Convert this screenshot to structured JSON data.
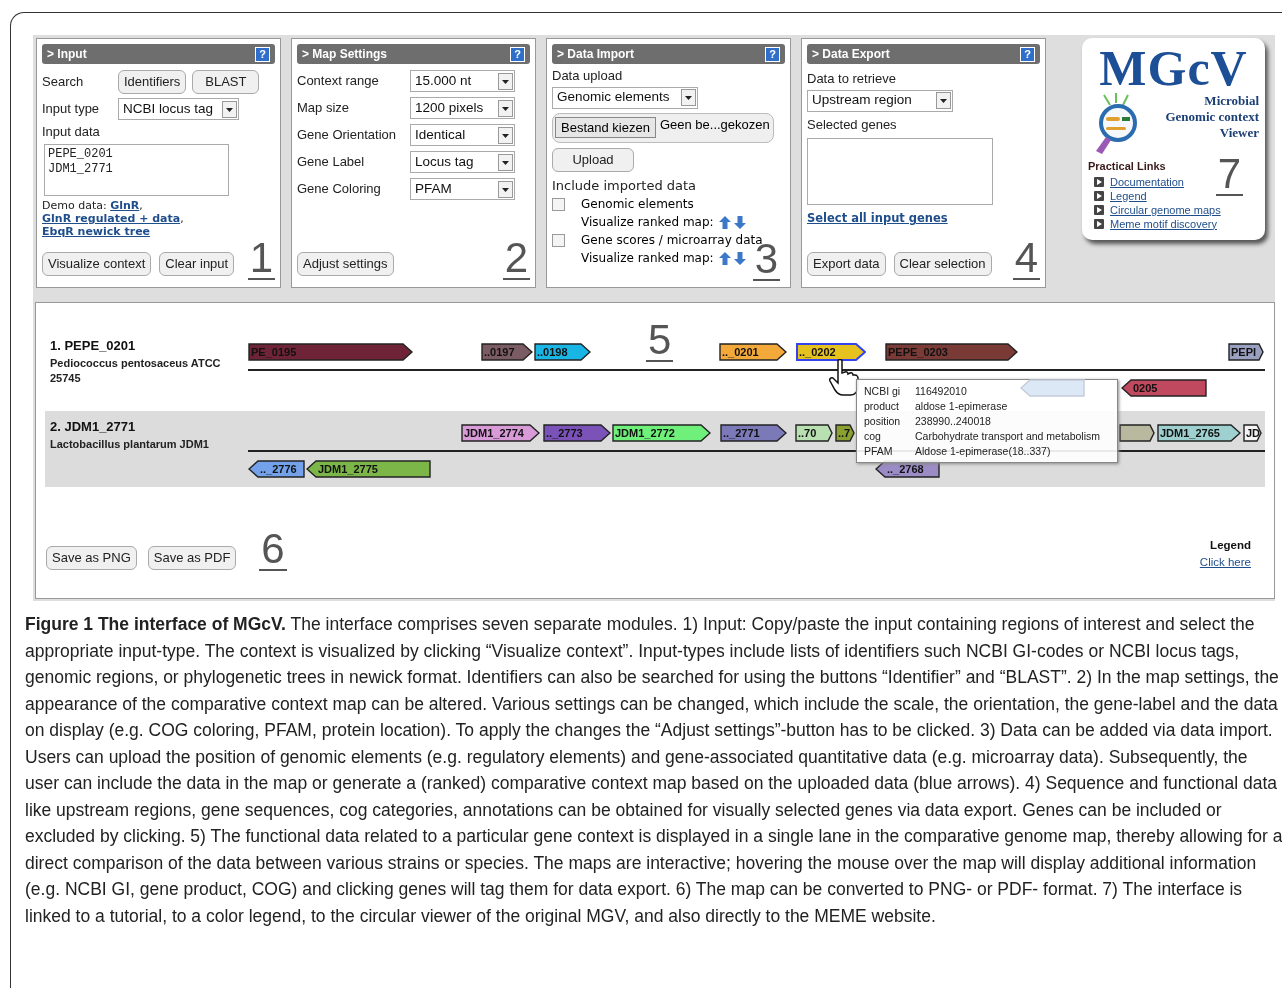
{
  "input_panel": {
    "title": "> Input",
    "help": "?",
    "search_label": "Search",
    "search_buttons": [
      "Identifiers",
      "BLAST"
    ],
    "input_type": {
      "label": "Input type",
      "value": "NCBI locus tag"
    },
    "input_data": {
      "label": "Input data",
      "value": "PEPE_0201\nJDM1_2771"
    },
    "demo": {
      "label": "Demo data:",
      "links": [
        {
          "text": "GlnR",
          "after": ","
        },
        {
          "text": "GlnR regulated + data",
          "after": ","
        },
        {
          "text": "EbqR newick tree"
        }
      ]
    },
    "buttons": [
      "Visualize context",
      "Clear input"
    ],
    "number": "1"
  },
  "map_settings": {
    "title": "> Map Settings",
    "help": "?",
    "rows": [
      {
        "label": "Context range",
        "value": "15.000 nt"
      },
      {
        "label": "Map size",
        "value": "1200 pixels"
      },
      {
        "label": "Gene Orientation",
        "value": "Identical"
      },
      {
        "label": "Gene Label",
        "value": "Locus tag"
      },
      {
        "label": "Gene Coloring",
        "value": "PFAM"
      }
    ],
    "button": "Adjust settings",
    "number": "2"
  },
  "data_import": {
    "title": "> Data Import",
    "help": "?",
    "upload_label": "Data upload",
    "upload_type": "Genomic elements",
    "file_button": "Bestand kiezen",
    "file_name": "Geen be...gekozen",
    "upload_button": "Upload",
    "include_label": "Include imported data",
    "options": [
      {
        "label": "Genomic elements",
        "checked": false,
        "ranked_label": "Visualize ranked map:"
      },
      {
        "label": "Gene scores / microarray data",
        "checked": false,
        "ranked_label": "Visualize ranked map:"
      }
    ],
    "number": "3"
  },
  "data_export": {
    "title": "> Data Export",
    "help": "?",
    "retrieve_label": "Data to retrieve",
    "retrieve_value": "Upstream region",
    "selected_label": "Selected genes",
    "select_all": "Select all input genes",
    "buttons": [
      "Export data",
      "Clear selection"
    ],
    "number": "4"
  },
  "logo_card": {
    "title": "MGcV",
    "subtitle": [
      "Microbial",
      "Genomic context",
      "Viewer"
    ],
    "links_title": "Practical Links",
    "links": [
      "Documentation",
      "Legend",
      "Circular genome maps",
      "Meme motif discovery"
    ],
    "number": "7"
  },
  "map": {
    "number": "5",
    "lanes": [
      {
        "title": "1. PEPE_0201",
        "organism": "Pediococcus pentosaceus ATCC 25745",
        "shaded": false,
        "genes": [
          {
            "label": "PE_0195",
            "kind": "forward",
            "color": "#6e2436",
            "highlighted": false,
            "faded": false
          },
          {
            "label": "..0197",
            "kind": "forward",
            "color": "#7a5c62",
            "highlighted": false,
            "faded": false
          },
          {
            "label": "..0198",
            "kind": "forward",
            "color": "#19b5e5",
            "highlighted": false,
            "faded": false
          },
          {
            "label": ".._0201",
            "kind": "forward",
            "color": "#f3a93a",
            "highlighted": false,
            "faded": false
          },
          {
            "label": ".._0202",
            "kind": "forward",
            "color": "#e6c21e",
            "highlighted": true,
            "faded": false
          },
          {
            "label": "PEPE_0203",
            "kind": "forward",
            "color": "#7a3a36",
            "highlighted": false,
            "faded": false
          },
          {
            "label": "PEPI",
            "kind": "forward",
            "color": "#9aa0c0",
            "highlighted": false,
            "faded": false
          },
          {
            "kind": "reverse",
            "color": "#dde8f6",
            "highlighted": false,
            "faded": true
          },
          {
            "label": "0205",
            "kind": "reverse",
            "color": "#c0485f",
            "highlighted": false,
            "faded": false
          }
        ]
      },
      {
        "title": "2. JDM1_2771",
        "organism": "Lactobacillus plantarum JDM1",
        "shaded": true,
        "genes": [
          {
            "label": "JDM1_2774",
            "kind": "forward",
            "color": "#d99ad8",
            "highlighted": false,
            "faded": false
          },
          {
            "label": ".._2773",
            "kind": "forward",
            "color": "#7a52b8",
            "highlighted": false,
            "faded": false
          },
          {
            "label": "JDM1_2772",
            "kind": "forward",
            "color": "#6ef07a",
            "highlighted": false,
            "faded": false
          },
          {
            "label": ".._2771",
            "kind": "forward",
            "color": "#7b79b8",
            "highlighted": false,
            "faded": false
          },
          {
            "label": "..70",
            "kind": "forward",
            "color": "#b8e0b0",
            "highlighted": false,
            "faded": false
          },
          {
            "label": "..7",
            "kind": "forward",
            "color": "#8aa030",
            "highlighted": false,
            "faded": false
          },
          {
            "kind": "forward",
            "color": "#b9b9a0",
            "highlighted": false,
            "faded": false
          },
          {
            "label": "JDM1_2765",
            "kind": "forward",
            "color": "#9fd0d0",
            "highlighted": false,
            "faded": false
          },
          {
            "label": "JD",
            "kind": "forward",
            "color": "#f4f4f4",
            "highlighted": false,
            "faded": false
          },
          {
            "label": ".._2776",
            "kind": "reverse",
            "color": "#74a2ea",
            "highlighted": false,
            "faded": false
          },
          {
            "label": "JDM1_2775",
            "kind": "reverse",
            "color": "#7cb548",
            "highlighted": false,
            "faded": false
          },
          {
            "label": ".._2768",
            "kind": "reverse",
            "color": "#9c8cc6",
            "highlighted": false,
            "faded": false
          }
        ]
      }
    ],
    "tooltip": [
      {
        "key": "NCBI gi",
        "value": "116492010"
      },
      {
        "key": "product",
        "value": "aldose 1-epimerase"
      },
      {
        "key": "position",
        "value": "238990..240018"
      },
      {
        "key": "cog",
        "value": "Carbohydrate transport and metabolism"
      },
      {
        "key": "PFAM",
        "value": "Aldose 1-epimerase(18..337)"
      }
    ],
    "save_buttons": [
      "Save as PNG",
      "Save as PDF"
    ],
    "save_number": "6",
    "legend": {
      "title": "Legend",
      "link": "Click here"
    }
  },
  "caption": "**Figure 1 The interface of MGcV.** The interface comprises seven separate modules. 1) Input: Copy/paste the input containing regions of interest and select the appropriate input-type. The context is visualized by clicking “Visualize context”. Input-types include lists of identifiers such NCBI GI-codes or NCBI locus tags, genomic regions, or phylogenetic trees in newick format. Identifiers can also be searched for using the buttons “Identifier” and “BLAST”. 2) In the map settings, the appearance of the comparative context map can be altered. Various settings can be changed, which include the scale, the orientation, the gene-label and the data on display (e.g. COG coloring, PFAM, protein location). To apply the changes the “Adjust settings”-button has to be clicked. 3) Data can be added via data import. Users can upload the position of genomic elements (e.g. regulatory elements) and gene-associated quantitative data (e.g. microarray data). Subsequently, the user can include the data in the map or generate a (ranked) comparative context map based on the uploaded data (blue arrows). 4) Sequence and functional data like upstream regions, gene sequences, cog categories, annotations can be obtained for visually selected genes via data export. Genes can be included or excluded by clicking. 5) The functional data related to a particular gene context is displayed in a single lane in the comparative genome map, thereby allowing for a direct comparison of the data between various strains or species. The maps are interactive; hovering the mouse over the map will display additional information (e.g. NCBI GI, gene product, COG) and clicking genes will tag them for data export. 6) The map can be converted to PNG- or PDF- format. 7) The interface is linked to a tutorial, to a color legend, to the circular viewer of the original MGV, and also directly to the MEME website."
}
